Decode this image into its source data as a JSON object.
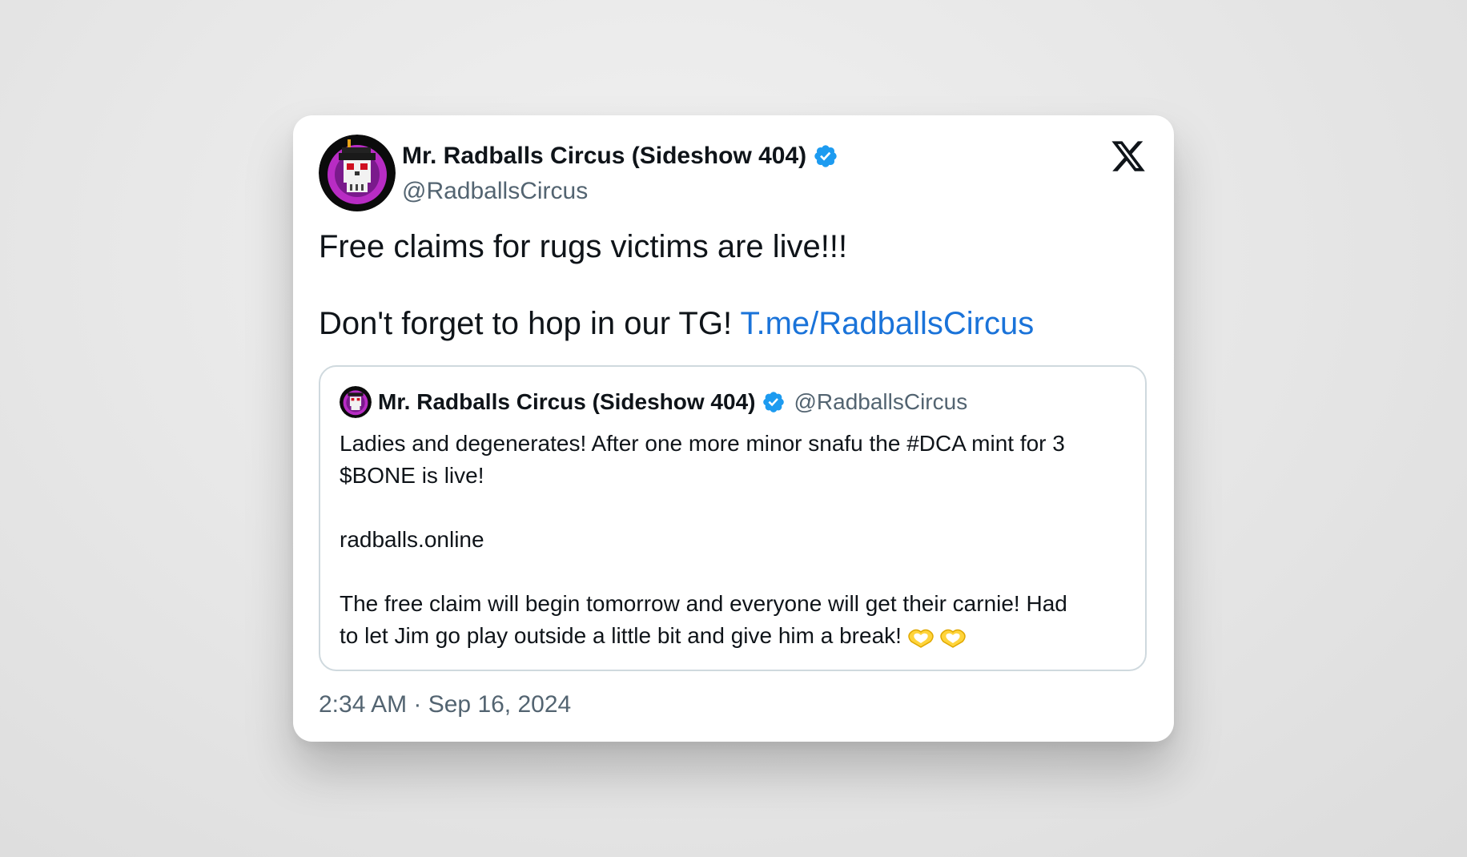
{
  "tweet": {
    "author": {
      "display_name": "Mr. Radballs Circus (Sideshow 404)",
      "handle": "@RadballsCircus",
      "verified": true
    },
    "text_line1": "Free claims for rugs victims are live!!!",
    "text_line2_prefix": "Don't forget to hop in our TG! ",
    "text_line2_link": "T.me/RadballsCircus",
    "timestamp": "2:34 AM · Sep 16, 2024"
  },
  "quoted_tweet": {
    "author": {
      "display_name": "Mr. Radballs Circus (Sideshow 404)",
      "handle": "@RadballsCircus",
      "verified": true
    },
    "lines": [
      "Ladies and degenerates! After one more minor snafu the #DCA mint for 3",
      "$BONE is live!",
      "",
      "radballs.online",
      "",
      "The free claim will begin tomorrow and everyone will get their carnie! Had",
      "to let Jim go play outside a little bit and give him a break!"
    ],
    "emoji": "heart-hands-emoji"
  },
  "icons": {
    "x_logo": "x-logo-icon",
    "verified": "verified-badge-icon"
  },
  "colors": {
    "link": "#1a73d9",
    "verified": "#1d9bf0",
    "secondary_text": "#536471",
    "border": "#cfd9de",
    "avatar_accent": "#b82cc4"
  }
}
